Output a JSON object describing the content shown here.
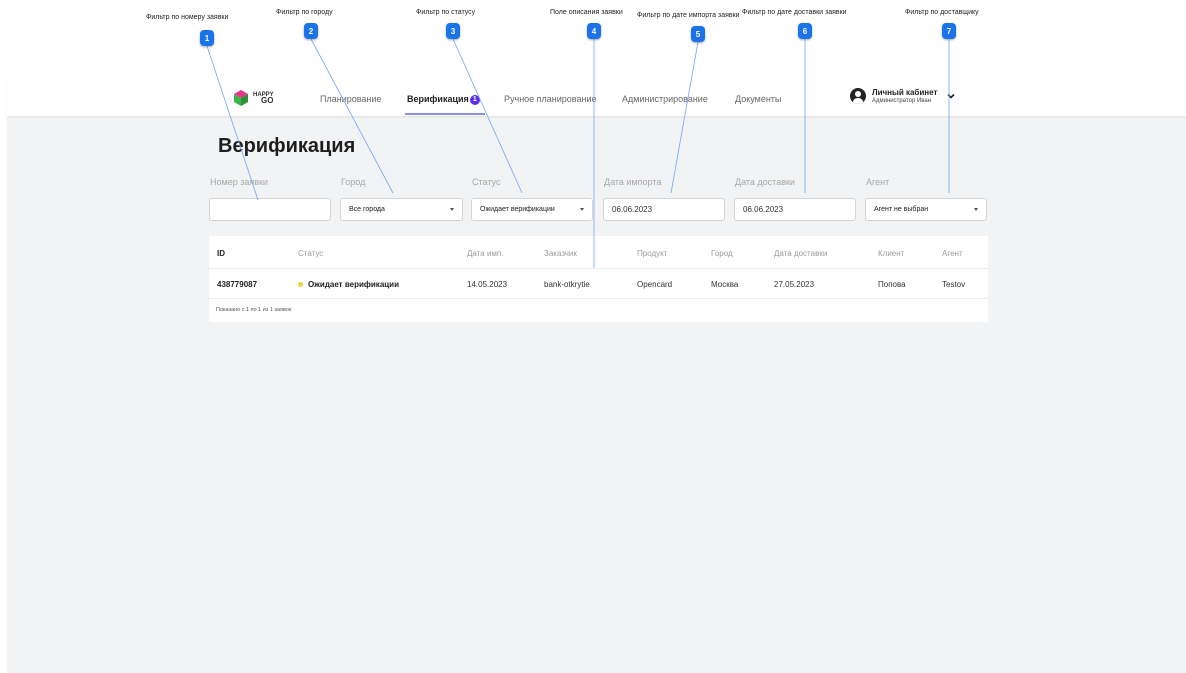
{
  "annotations": [
    {
      "num": "1",
      "label": "Фильтр по номеру заявки"
    },
    {
      "num": "2",
      "label": "Фильтр по городу"
    },
    {
      "num": "3",
      "label": "Фильтр по статусу"
    },
    {
      "num": "4",
      "label": "Поле описания заявки"
    },
    {
      "num": "5",
      "label": "Фильтр по дате импорта заявки"
    },
    {
      "num": "6",
      "label": "Фильтр по дате доставки заявки"
    },
    {
      "num": "7",
      "label": "Фильтр по доставщику"
    }
  ],
  "header": {
    "logo_top": "HAPPY",
    "logo_bottom": "GO",
    "nav": [
      {
        "label": "Планирование"
      },
      {
        "label": "Верификация",
        "badge": "1"
      },
      {
        "label": "Ручное планирование"
      },
      {
        "label": "Администрирование"
      },
      {
        "label": "Документы"
      }
    ],
    "profile": {
      "name": "Личный кабинет",
      "role": "Администратор Иван"
    }
  },
  "page": {
    "title": "Верификация"
  },
  "filters": {
    "order_number": {
      "label": "Номер заявки",
      "value": ""
    },
    "city": {
      "label": "Город",
      "value": "Все города"
    },
    "status": {
      "label": "Статус",
      "value": "Ожидает верификации"
    },
    "import_date": {
      "label": "Дата импорта",
      "value": "06.06.2023"
    },
    "delivery_date": {
      "label": "Дата доставки",
      "value": "06.06.2023"
    },
    "agent": {
      "label": "Агент",
      "value": "Агент не выбран"
    }
  },
  "table": {
    "columns": [
      "ID",
      "Статус",
      "Дата имп.",
      "Заказчик",
      "Продукт",
      "Город",
      "Дата доставки",
      "Клиент",
      "Агент"
    ],
    "rows": [
      {
        "id": "438779087",
        "status": "Ожидает верификации",
        "import_date": "14.05.2023",
        "customer": "bank-otkrytie",
        "product": "Opencard",
        "city": "Москва",
        "delivery_date": "27.05.2023",
        "client": "Попова",
        "agent": "Testov"
      }
    ],
    "footer": "Показано с 1 по 1 из 1 заявок"
  },
  "colors": {
    "accent": "#5b2ee6",
    "annotation": "#1a73e8",
    "status_pending": "#f2d53c"
  }
}
